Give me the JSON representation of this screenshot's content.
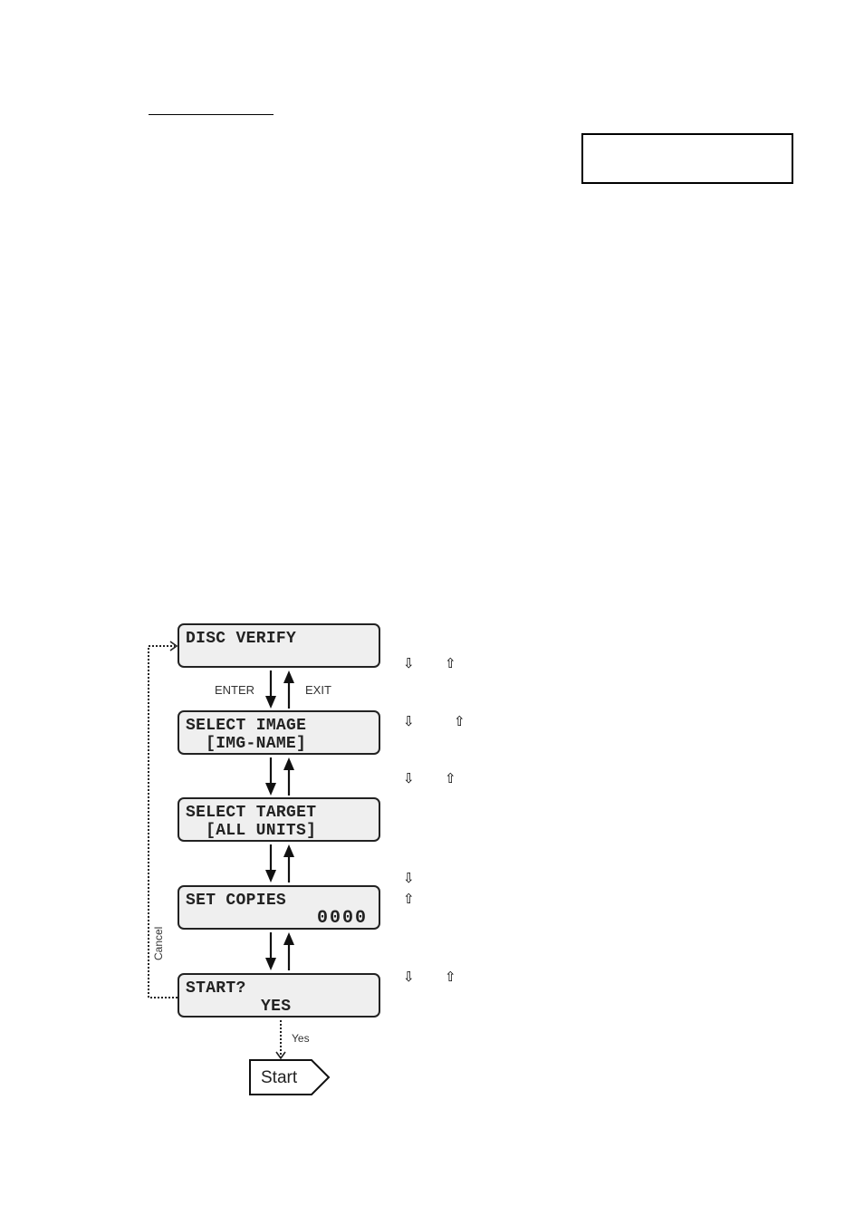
{
  "document": {
    "heading_text": "",
    "header_box_text": ""
  },
  "diagram": {
    "screens": [
      {
        "id": "disc-verify",
        "line1": "DISC VERIFY",
        "line2": ""
      },
      {
        "id": "select-image",
        "line1": "SELECT IMAGE",
        "line2": " [IMG-NAME]"
      },
      {
        "id": "select-target",
        "line1": "SELECT TARGET",
        "line2": " [ALL UNITS]"
      },
      {
        "id": "set-copies",
        "line1": "SET COPIES",
        "line2": "0000"
      },
      {
        "id": "start-confirm",
        "line1": "START?",
        "line2": "YES"
      }
    ],
    "transitions": {
      "enter_label": "ENTER",
      "exit_label": "EXIT",
      "cancel_label": "Cancel",
      "yes_label": "Yes"
    },
    "terminal": {
      "label": "Start"
    },
    "key_icons": {
      "down": "⇩",
      "up": "⇧"
    }
  }
}
